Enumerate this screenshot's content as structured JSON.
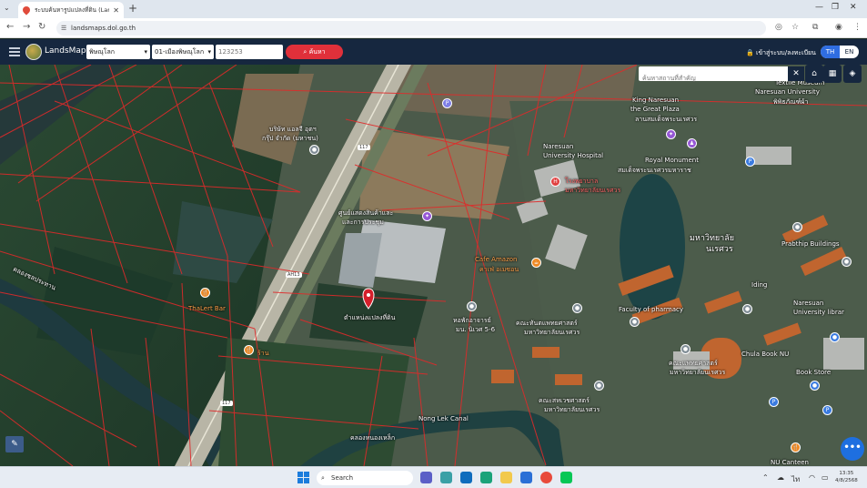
{
  "browser": {
    "tab_title": "ระบบค้นหารูปแปลงที่ดิน (LandsMa...",
    "url": "landsmaps.dol.go.th"
  },
  "header": {
    "brand": "LandsMaps",
    "province": "พิษณุโลก",
    "district": "01-เมืองพิษณุโลก",
    "parcel_value": "123253",
    "search_button": "ค้นหา",
    "login": "เข้าสู่ระบบ/ลงทะเบียน",
    "lang_th": "TH",
    "lang_en": "EN"
  },
  "map": {
    "search_placeholder": "ค้นหาสถานที่สำคัญ",
    "labels": {
      "poi_company": "บริษัท แอลจี อุตฯ",
      "poi_company2": "กรุ๊ป จำกัด (มหาชน)",
      "route_117_top": "117",
      "route_117_bottom": "117",
      "ah13": "AH13",
      "exhibition": "ศูนย์แสดงสินค้าและ",
      "exhibition2": "และการประชุม",
      "naresuan_hosp": "Naresuan",
      "naresuan_hosp2": "University Hospital",
      "hosp_th": "โรงพยาบาล",
      "hosp_th2": "มหาวิทยาลัยนเรศวร",
      "king_naresuan": "King Naresuan",
      "king_naresuan2": "the Great Plaza",
      "king_th": "ลานสมเด็จพระนเรศวร",
      "royal_monument": "Royal Monument",
      "royal_th": "สมเด็จพระนเรศวรมหาราช",
      "textile": "Textile Museum",
      "textile2": "Naresuan University",
      "textile3": "พิพิธภัณฑ์ผ้า",
      "uni": "มหาวิทยาลัย",
      "uni2": "นเรศวร",
      "cafe": "Cafe Amazon",
      "cafe2": "คาเฟ่ อเมซอน",
      "prabthip": "Prabthip Buildings",
      "parcel_pin": "ตำแหน่งแปลงที่ดิน",
      "thalert": "ThaLert Bar",
      "dorm": "หอพักอาจารย์",
      "dorm2": "มน. นิเวศ 5-6",
      "dent": "คณะทันตแพทยศาสตร์",
      "dent2": "มหาวิทยาลัยนเรศวร",
      "pharmacy": "Faculty of pharmacy",
      "iding": "Iding",
      "nu_library": "Naresuan",
      "nu_library2": "University librar",
      "chula": "Chula Book NU",
      "chula2": "Book Store",
      "med": "คณะแพทยศาสตร์",
      "med2": "มหาวิทยาลัยนเรศวร",
      "allied": "คณะสหเวชศาสตร์",
      "allied2": "มหาวิทยาลัยนเรศวร",
      "nong_lek": "Nong Lek Canal",
      "nong_lek_th": "คลองหนองเหล็ก",
      "canal_th": "คลองชลประทาน",
      "nu_canteen": "NU Canteen",
      "small_shop": "ร้าน"
    }
  },
  "taskbar": {
    "search": "Search",
    "time": "13:35",
    "date": "4/8/2568"
  },
  "colors": {
    "parcel_line": "#e02a2a",
    "header_bg": "#16273f",
    "search_button": "#e0303a",
    "accent_blue": "#1e6fe0"
  }
}
